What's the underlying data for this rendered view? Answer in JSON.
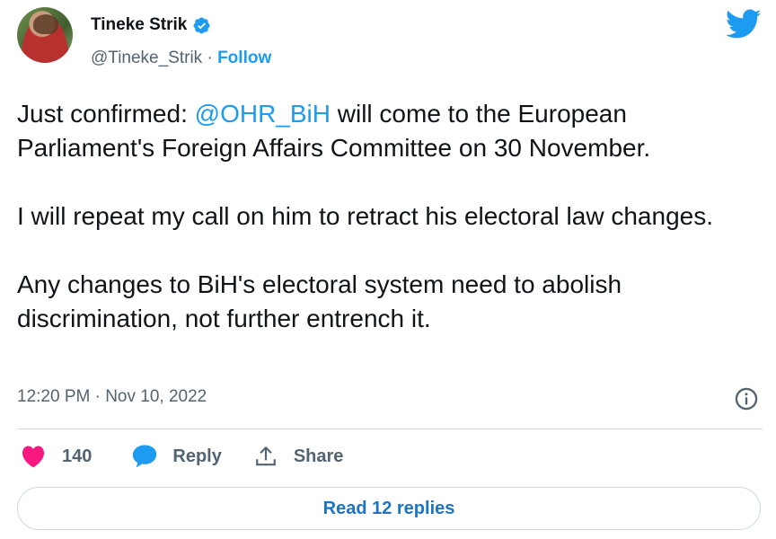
{
  "author": {
    "name": "Tineke Strik",
    "handle": "@Tineke_Strik",
    "separator": "·",
    "follow_label": "Follow"
  },
  "tweet": {
    "line1_prefix": "Just confirmed: ",
    "mention": "@OHR_BiH",
    "line1_suffix": " will come to the European Parliament's Foreign Affairs Committee on 30 November.",
    "paragraph2": "I will repeat my call on him to retract his electoral law changes.",
    "paragraph3": "Any changes to BiH's electoral system need to abolish discrimination, not further entrench it."
  },
  "timestamp": "12:20 PM · Nov 10, 2022",
  "actions": {
    "likes": "140",
    "reply_label": "Reply",
    "share_label": "Share"
  },
  "read_replies_label": "Read 12 replies",
  "colors": {
    "accent": "#1d9bf0",
    "like": "#f91880",
    "secondary_text": "#536471"
  },
  "icons": [
    "twitter-bird-icon",
    "verified-badge-icon",
    "info-icon",
    "heart-icon",
    "reply-bubble-icon",
    "share-icon"
  ]
}
